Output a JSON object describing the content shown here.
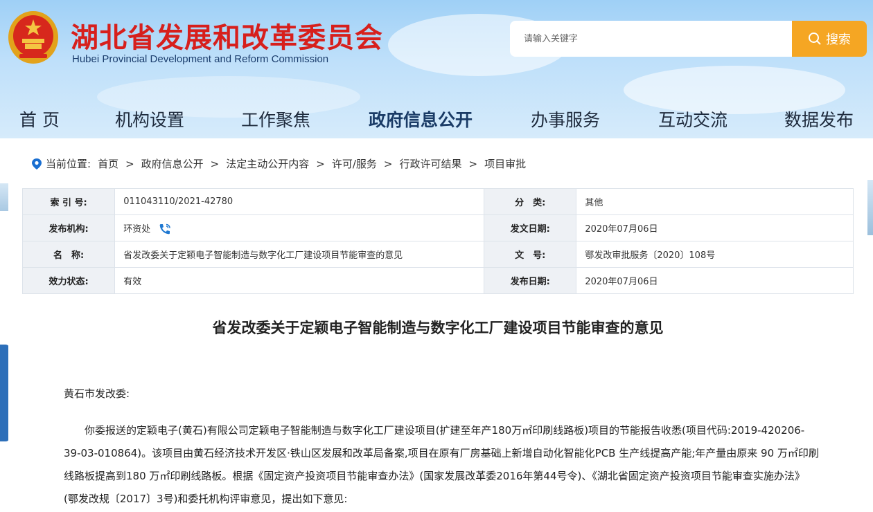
{
  "header": {
    "site_title": "湖北省发展和改革委员会",
    "site_subtitle": "Hubei Provincial Development and Reform Commission",
    "search_placeholder": "请输入关键字",
    "search_button": "搜索"
  },
  "nav": {
    "items": [
      "首 页",
      "机构设置",
      "工作聚焦",
      "政府信息公开",
      "办事服务",
      "互动交流",
      "数据发布"
    ],
    "active": "政府信息公开"
  },
  "breadcrumb": {
    "label": "当前位置:",
    "items": [
      "首页",
      "政府信息公开",
      "法定主动公开内容",
      "许可/服务",
      "行政许可结果",
      "项目审批"
    ],
    "separator": ">"
  },
  "meta": {
    "rows": [
      [
        {
          "label": "索 引 号:",
          "value": "011043110/2021-42780"
        },
        {
          "label": "分　类:",
          "value": "其他"
        }
      ],
      [
        {
          "label": "发布机构:",
          "value": "环资处"
        },
        {
          "label": "发文日期:",
          "value": "2020年07月06日"
        }
      ],
      [
        {
          "label": "名　称:",
          "value": "省发改委关于定颖电子智能制造与数字化工厂建设项目节能审查的意见"
        },
        {
          "label": "文　号:",
          "value": "鄂发改审批服务〔2020〕108号"
        }
      ],
      [
        {
          "label": "效力状态:",
          "value": "有效"
        },
        {
          "label": "发布日期:",
          "value": "2020年07月06日"
        }
      ]
    ]
  },
  "document": {
    "title": "省发改委关于定颖电子智能制造与数字化工厂建设项目节能审查的意见",
    "salutation": "黄石市发改委:",
    "paragraph": "你委报送的定颖电子(黄石)有限公司定颖电子智能制造与数字化工厂建设项目(扩建至年产180万㎡印刷线路板)项目的节能报告收悉(项目代码:2019-420206-39-03-010864)。该项目由黄石经济技术开发区·铁山区发展和改革局备案,项目在原有厂房基础上新增自动化智能化PCB 生产线提高产能;年产量由原来 90 万㎡印刷线路板提高到180 万㎡印刷线路板。根据《固定资产投资项目节能审查办法》(国家发展改革委2016年第44号令)、《湖北省固定资产投资项目节能审查实施办法》(鄂发改规〔2017〕3号)和委托机构评审意见，提出如下意见:"
  },
  "colors": {
    "title_red": "#d71f1c",
    "search_orange": "#f5a623",
    "nav_text": "#1e2a3c",
    "label_bg": "#eef1f5"
  }
}
